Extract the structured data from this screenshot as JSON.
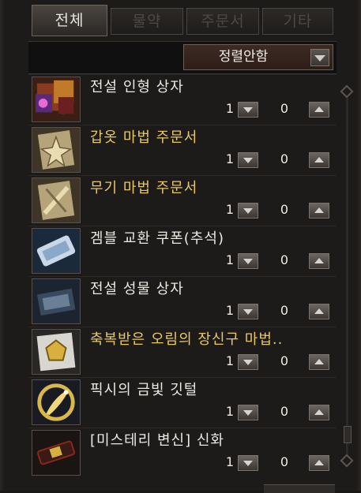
{
  "tabs": [
    {
      "label": "전체"
    },
    {
      "label": "물약"
    },
    {
      "label": "주문서"
    },
    {
      "label": "기타"
    }
  ],
  "sort": {
    "label": "정렬안함",
    "icon": "chevron-down-icon"
  },
  "items": [
    {
      "name": "전설 인형 상자",
      "color": "white",
      "qty": "1",
      "count": "0",
      "icon": "doll-box-icon"
    },
    {
      "name": "갑옷 마법 주문서",
      "color": "gold",
      "qty": "1",
      "count": "0",
      "icon": "armor-scroll-icon"
    },
    {
      "name": "무기 마법 주문서",
      "color": "gold",
      "qty": "1",
      "count": "0",
      "icon": "weapon-scroll-icon"
    },
    {
      "name": "겜블 교환 쿠폰(추석)",
      "color": "white",
      "qty": "1",
      "count": "0",
      "icon": "coupon-icon"
    },
    {
      "name": "전설 성물 상자",
      "color": "white",
      "qty": "1",
      "count": "0",
      "icon": "relic-box-icon"
    },
    {
      "name": "축복받은 오림의 장신구 마법..",
      "color": "gold",
      "qty": "1",
      "count": "0",
      "icon": "accessory-scroll-icon"
    },
    {
      "name": "픽시의 금빛 깃털",
      "color": "white",
      "qty": "1",
      "count": "0",
      "icon": "golden-feather-icon"
    },
    {
      "name": "[미스테리 변신] 신화",
      "color": "white",
      "qty": "1",
      "count": "0",
      "icon": "transform-ticket-icon"
    }
  ]
}
